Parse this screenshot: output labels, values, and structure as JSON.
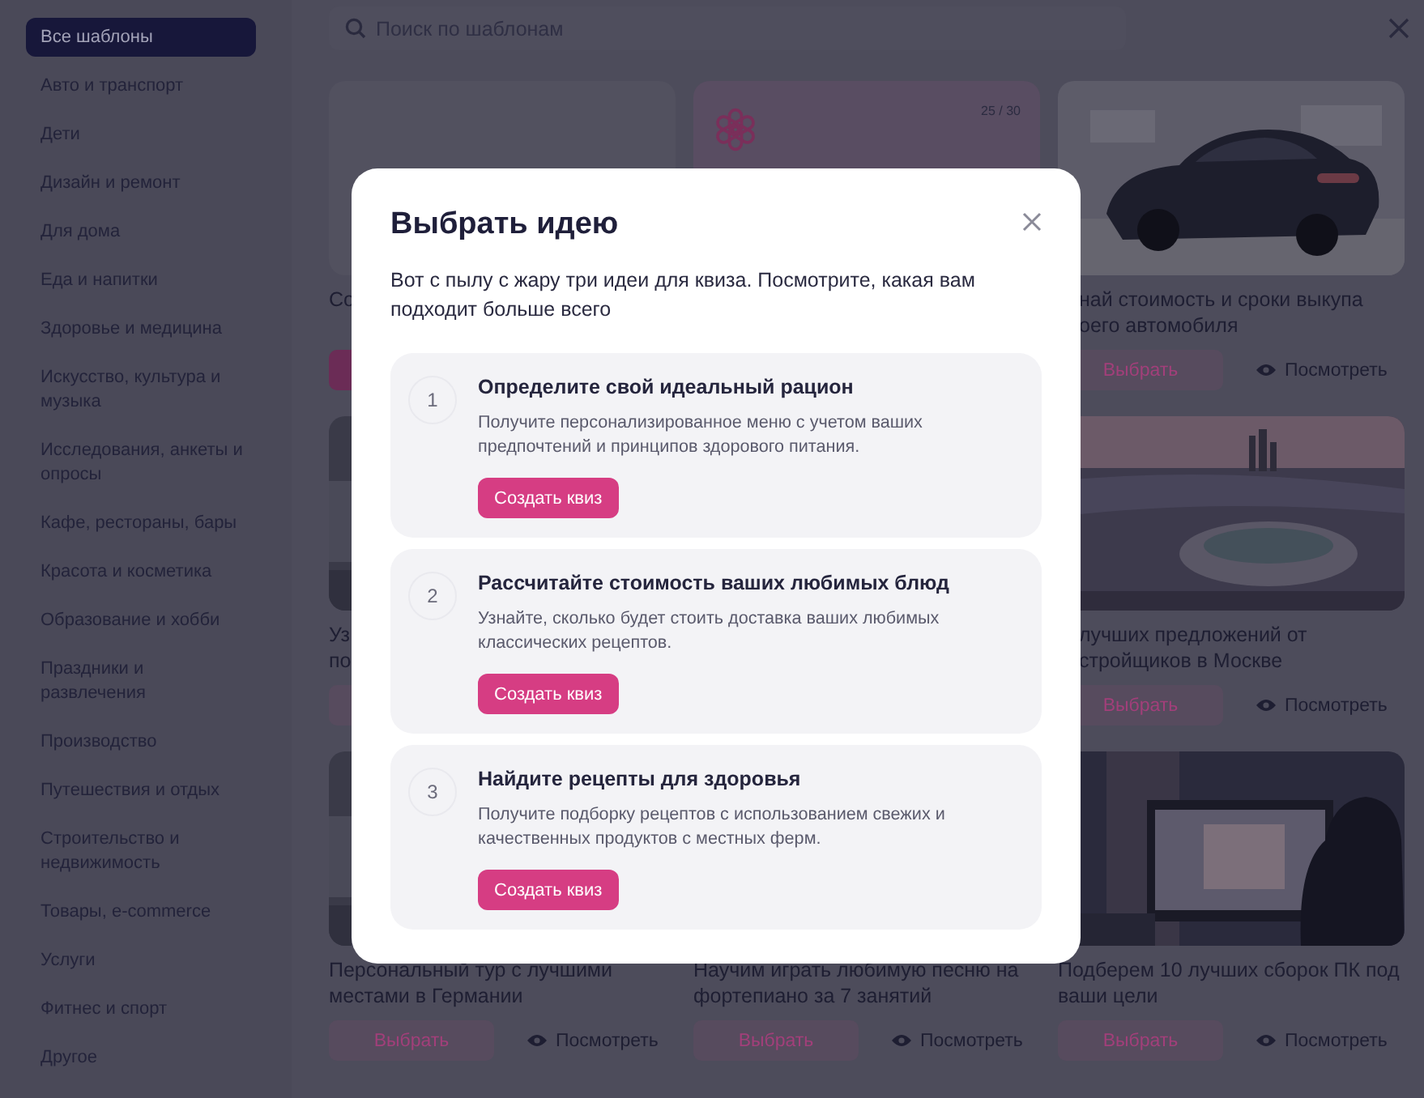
{
  "sidebar": {
    "items": [
      {
        "label": "Все шаблоны",
        "selected": true
      },
      {
        "label": "Авто и транспорт",
        "selected": false
      },
      {
        "label": "Дети",
        "selected": false
      },
      {
        "label": "Дизайн и ремонт",
        "selected": false
      },
      {
        "label": "Для дома",
        "selected": false
      },
      {
        "label": "Еда и напитки",
        "selected": false
      },
      {
        "label": "Здоровье и медицина",
        "selected": false
      },
      {
        "label": "Искусство, культура и музыка",
        "selected": false
      },
      {
        "label": "Исследования, анкеты и опросы",
        "selected": false
      },
      {
        "label": "Кафе, рестораны, бары",
        "selected": false
      },
      {
        "label": "Красота и косметика",
        "selected": false
      },
      {
        "label": "Образование и хобби",
        "selected": false
      },
      {
        "label": "Праздники и развлечения",
        "selected": false
      },
      {
        "label": "Производство",
        "selected": false
      },
      {
        "label": "Путешествия и отдых",
        "selected": false
      },
      {
        "label": "Строительство и недвижимость",
        "selected": false
      },
      {
        "label": "Товары, e-commerce",
        "selected": false
      },
      {
        "label": "Услуги",
        "selected": false
      },
      {
        "label": "Фитнес и спорт",
        "selected": false
      },
      {
        "label": "Другое",
        "selected": false
      }
    ]
  },
  "search": {
    "placeholder": "Поиск по шаблонам"
  },
  "cards": [
    {
      "kind": "blank",
      "title_lines": [
        "Со"
      ],
      "stub": {
        "kind": "primary"
      }
    },
    {
      "kind": "ai",
      "badge": "25 / 30"
    },
    {
      "kind": "car",
      "title_lines": [
        "най стоимость и сроки выкупа",
        "оего автомобиля"
      ],
      "choose": "Выбрать",
      "view": "Посмотреть"
    },
    {
      "kind": "sliver",
      "title_lines": [
        "Уз",
        "по"
      ],
      "stub": {
        "kind": "light"
      }
    },
    {
      "kind": "covered"
    },
    {
      "kind": "city",
      "title_lines": [
        "лучших предложений от",
        "стройщиков в Москве"
      ],
      "choose": "Выбрать",
      "view": "Посмотреть"
    },
    {
      "kind": "sliver",
      "title": "Персональный тур с лучшими местами в Германии",
      "choose": "Выбрать",
      "view": "Посмотреть"
    },
    {
      "kind": "covered",
      "title": "Научим играть любимую песню на фортепиано за 7 занятий",
      "choose": "Выбрать",
      "view": "Посмотреть"
    },
    {
      "kind": "desk",
      "title": "Подберем 10 лучших сборок ПК под ваши цели",
      "choose": "Выбрать",
      "view": "Посмотреть"
    }
  ],
  "modal": {
    "title": "Выбрать идею",
    "description": "Вот с пылу с жару три идеи для квиза. Посмотрите, какая вам подходит больше всего",
    "ideas": [
      {
        "number": "1",
        "title": "Определите свой идеальный рацион",
        "description": "Получите персонализированное меню с учетом ваших предпочтений и принципов здорового питания.",
        "button": "Создать квиз"
      },
      {
        "number": "2",
        "title": "Рассчитайте стоимость ваших любимых блюд",
        "description": "Узнайте, сколько будет стоить доставка ваших любимых классических рецептов.",
        "button": "Создать квиз"
      },
      {
        "number": "3",
        "title": "Найдите рецепты для здоровья",
        "description": "Получите подборку рецептов с использованием свежих и качественных продуктов с местных ферм.",
        "button": "Создать квиз"
      }
    ]
  }
}
